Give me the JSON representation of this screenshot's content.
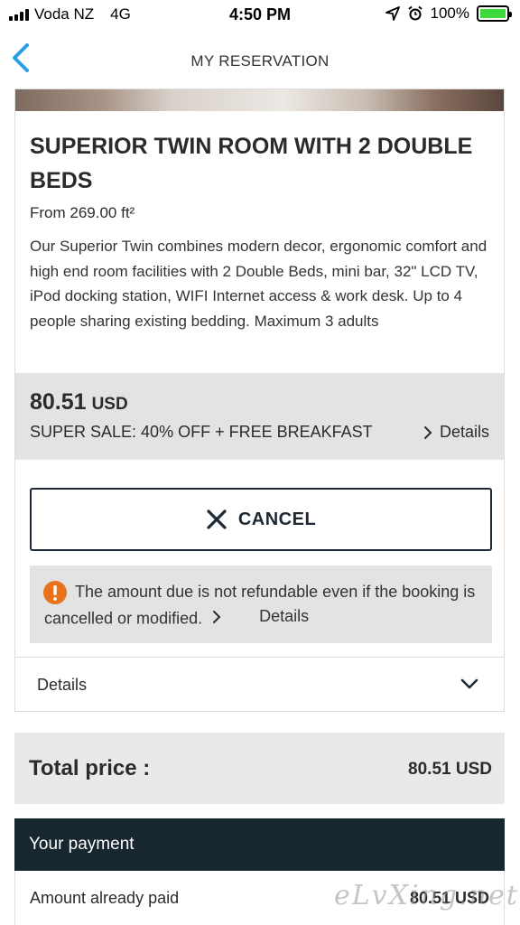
{
  "status_bar": {
    "carrier": "Voda NZ",
    "network": "4G",
    "time": "4:50 PM",
    "battery_percent_label": "100%",
    "battery_level": 1.0,
    "icons": [
      "signal-icon",
      "location-icon",
      "alarm-icon",
      "battery-icon"
    ]
  },
  "nav": {
    "title": "MY RESERVATION",
    "back_icon": "chevron-left-icon"
  },
  "room": {
    "title": "SUPERIOR TWIN ROOM WITH 2 DOUBLE BEDS",
    "size": "From 269.00 ft²",
    "description": "Our Superior Twin combines modern decor, ergonomic comfort and high end room facilities with 2 Double Beds, mini bar, 32\" LCD TV, iPod docking station, WIFI Internet access & work desk. Up to 4 people sharing existing bedding. Maximum 3 adults"
  },
  "rate": {
    "price": "80.51",
    "currency": "USD",
    "offer": "SUPER SALE: 40% OFF + FREE BREAKFAST",
    "details_label": "Details"
  },
  "cancel": {
    "label": "CANCEL"
  },
  "warning": {
    "text": "The amount due is not refundable even if the booking is cancelled or modified.",
    "details_label": "Details",
    "icon_color": "#e8731c"
  },
  "details_row": {
    "label": "Details"
  },
  "total": {
    "label": "Total price :",
    "value": "80.51 USD"
  },
  "payment": {
    "header": "Your payment",
    "paid_label": "Amount already paid",
    "paid_value": "80.51 USD"
  },
  "watermark": "eLvXing.net",
  "colors": {
    "accent_blue": "#2a9fe8",
    "dark_navy": "#17262f",
    "battery_green": "#3cd83c"
  }
}
